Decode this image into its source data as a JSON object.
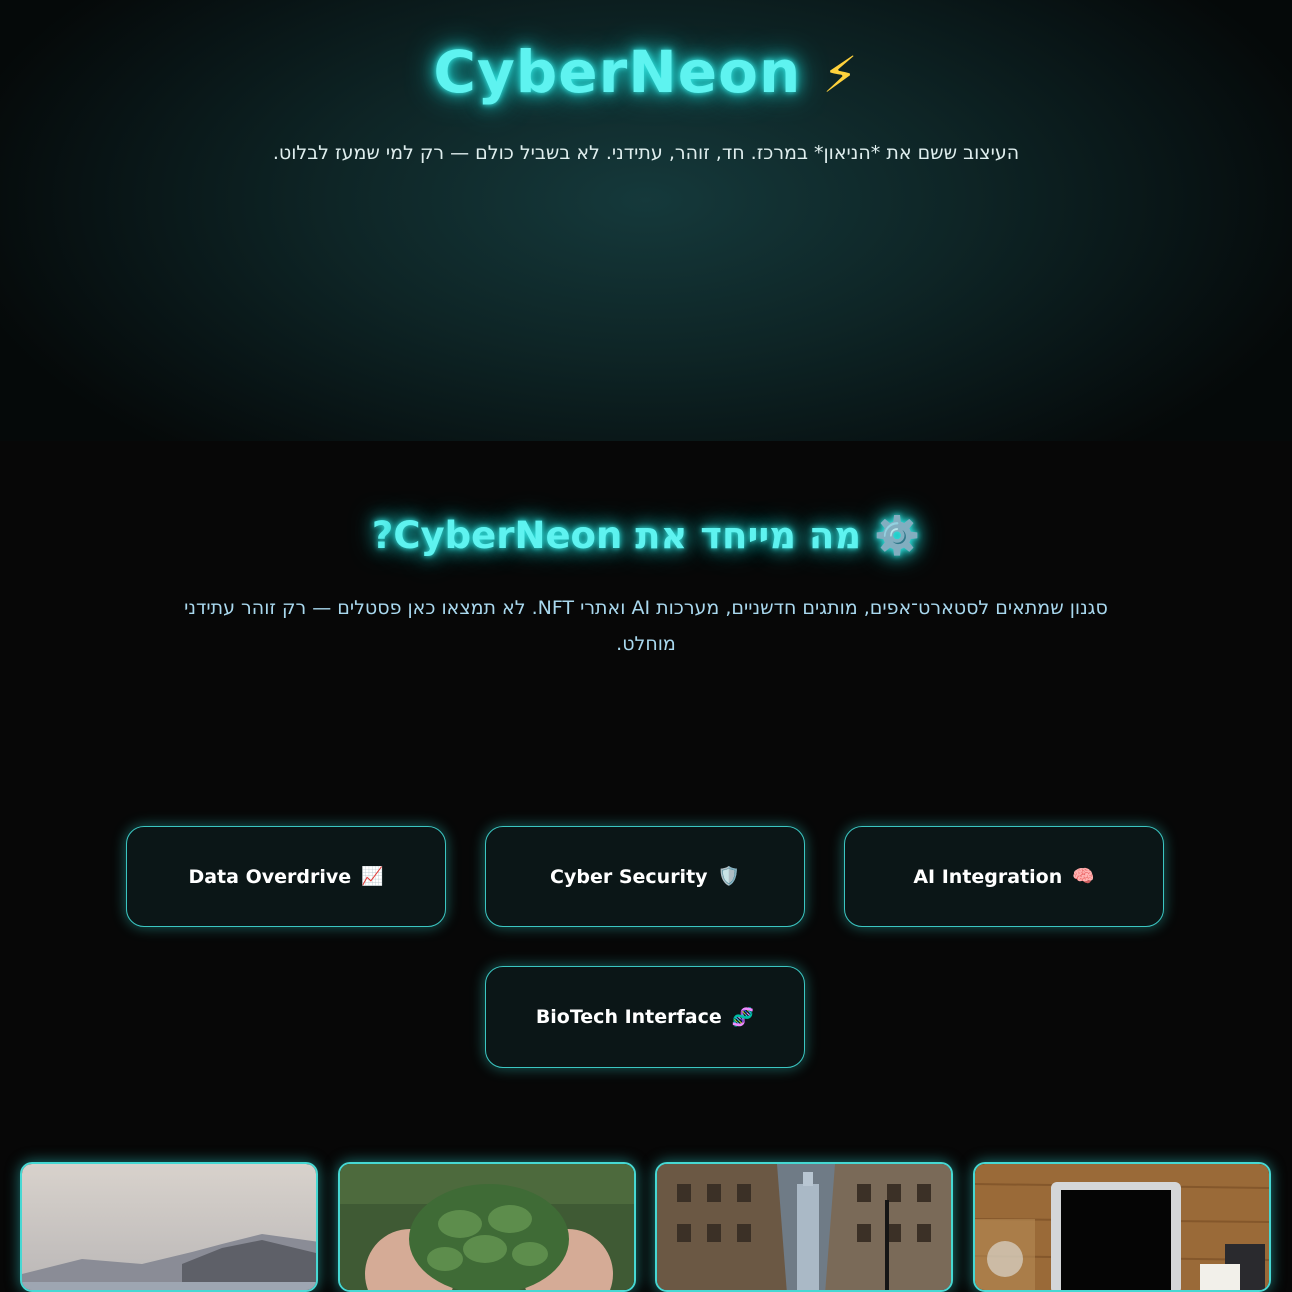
{
  "hero": {
    "title": "CyberNeon",
    "title_icon": "⚡",
    "subtitle": "העיצוב ששם את *הניאון* במרכז. חד, זוהר, עתידני. לא בשביל כולם — רק למי שמעז לבלוט."
  },
  "about": {
    "title_icon": "⚙️",
    "title": "מה מייחד את CyberNeon?",
    "text": "סגנון שמתאים לסטארט־אפים, מותגים חדשניים, מערכות AI ואתרי NFT. לא תמצאו כאן פסטלים — רק זוהר עתידני מוחלט."
  },
  "features": [
    {
      "label": "AI Integration",
      "icon": "🧠",
      "icon_name": "brain-icon"
    },
    {
      "label": "Cyber Security",
      "icon": "🛡️",
      "icon_name": "shield-icon"
    },
    {
      "label": "Data Overdrive",
      "icon": "📈",
      "icon_name": "chart-increasing-icon"
    },
    {
      "label": "BioTech Interface",
      "icon": "🧬",
      "icon_name": "dna-icon"
    }
  ],
  "gallery": [
    {
      "subject": "laptop on wooden desk"
    },
    {
      "subject": "city street with skyscrapers"
    },
    {
      "subject": "hands holding green pine cones"
    },
    {
      "subject": "misty coastline"
    }
  ],
  "colors": {
    "neon": "#5ef3f0",
    "background": "#070707",
    "card_border": "#3bc6c2",
    "text_light": "#a9d8ee",
    "bolt": "#ffd23c"
  }
}
